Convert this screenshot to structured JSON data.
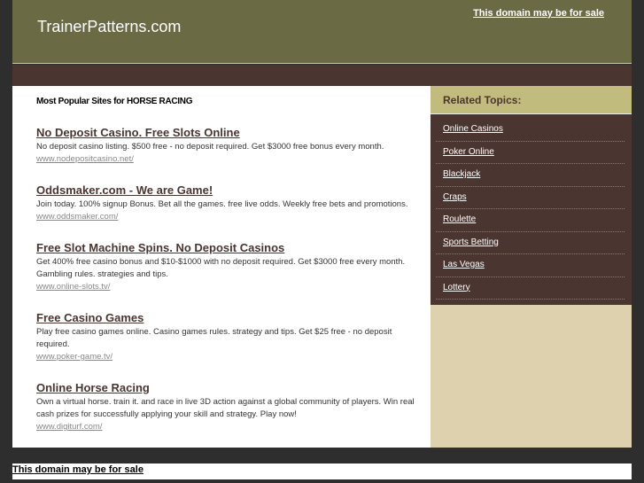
{
  "header": {
    "site_title": "TrainerPatterns.com",
    "sale_link": "This domain may be for sale"
  },
  "main": {
    "heading": "Most Popular Sites for HORSE RACING",
    "results": [
      {
        "title": "No Deposit Casino. Free Slots Online",
        "desc": "No deposit casino listing. $500 free - no deposit required. Get $3000 free bonus every month.",
        "url": "www.nodepositcasino.net/"
      },
      {
        "title": "Oddsmaker.com - We are Game!",
        "desc": "Join today. 100% signup Bonus. Bet all the games. free live odds. Weekly free bets and promotions.",
        "url": "www.oddsmaker.com/"
      },
      {
        "title": "Free Slot Machine Spins. No Deposit Casinos",
        "desc": "Get 400% free casino bonus and $10-$1000 with no deposit required. Get $3000 free every month. Gambling rules. strategies and tips.",
        "url": "www.online-slots.tv/"
      },
      {
        "title": "Free Casino Games",
        "desc": "Play free casino games online. Casino games rules. strategy and tips. Get $25 free - no deposit required.",
        "url": "www.poker-game.tv/"
      },
      {
        "title": "Online Horse Racing",
        "desc": "Own a virtual horse. train it. and race in live 3D action against a global community of players. Win real cash prizes for successfully applying your skill and strategy. Play now!",
        "url": "www.digiturf.com/"
      }
    ]
  },
  "sidebar": {
    "heading": "Related Topics:",
    "items": [
      "Online Casinos",
      "Poker Online",
      "Blackjack",
      "Craps",
      "Roulette",
      "Sports Betting",
      "Las Vegas",
      "Lottery"
    ]
  },
  "footer": {
    "sale_link": "This domain may be for sale"
  }
}
